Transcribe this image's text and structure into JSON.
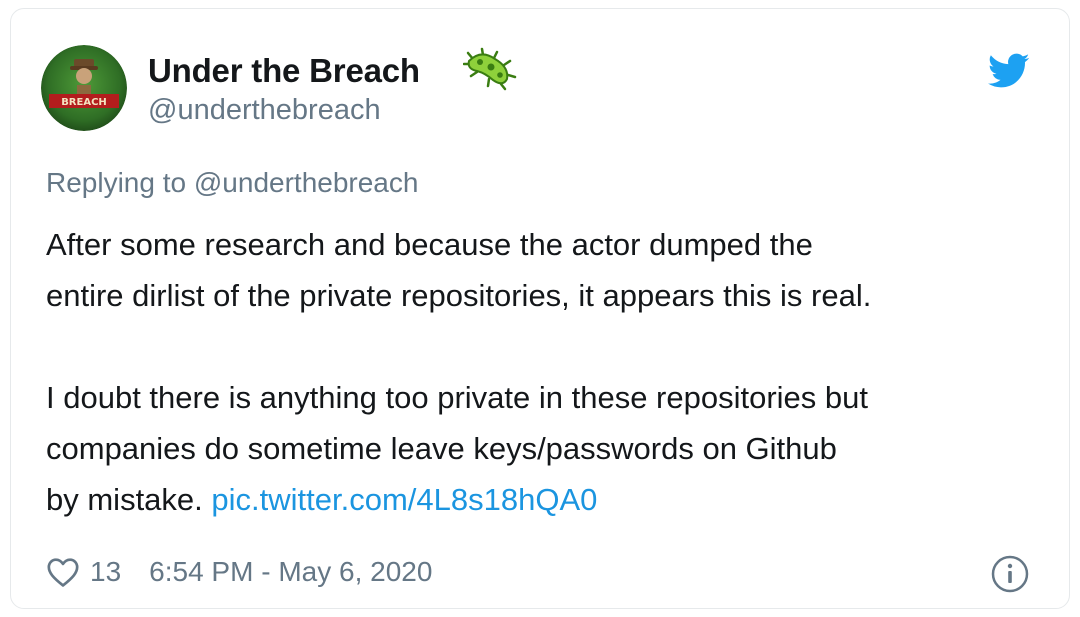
{
  "tweet": {
    "display_name": "Under the Breach",
    "handle": "@underthebreach",
    "avatar_text": "BREACH",
    "reply_prefix": "Replying to",
    "reply_handle": "@underthebreach",
    "text_lines": [
      "After some research and because the actor dumped the",
      "entire dirlist of the private repositories, it appears this is real.",
      "",
      "I doubt there is anything too private in these repositories but",
      "companies do sometime leave keys/passwords on Github",
      "by mistake."
    ],
    "link": "pic.twitter.com/4L8s18hQA0",
    "likes": "13",
    "timestamp": "6:54 PM - May 6, 2020"
  },
  "icons": {
    "name_emoji": "microbe-icon",
    "brand": "twitter-bird-icon",
    "like": "heart-icon",
    "info": "info-icon"
  },
  "colors": {
    "text": "#14171a",
    "secondary": "#657786",
    "link": "#1b95e0",
    "twitter_blue": "#1da1f2"
  }
}
